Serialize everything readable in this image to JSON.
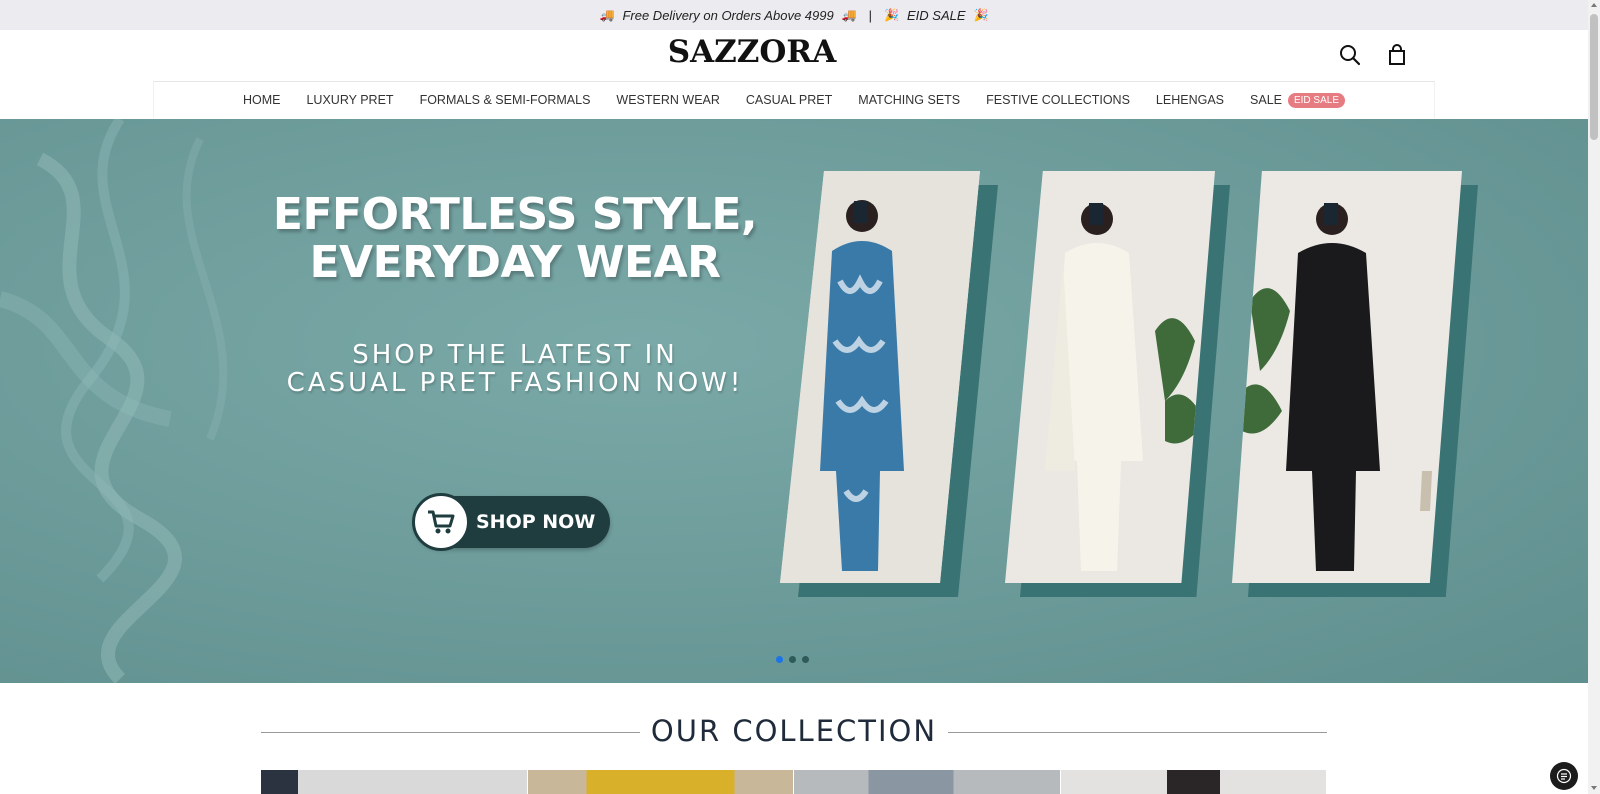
{
  "announcement": {
    "left_emoji": "🚚",
    "free_delivery": "Free Delivery on Orders Above 4999",
    "right_emoji": "🚚",
    "separator": "|",
    "sale_emoji": "🎉",
    "eid_sale": "EID SALE",
    "sale_emoji_end": "🎉"
  },
  "header": {
    "logo": "SAZZORA",
    "icons": [
      "search-icon",
      "shopping-bag-icon"
    ]
  },
  "nav": {
    "items": [
      {
        "label": "HOME"
      },
      {
        "label": "LUXURY PRET"
      },
      {
        "label": "FORMALS & SEMI-FORMALS"
      },
      {
        "label": "WESTERN WEAR"
      },
      {
        "label": "CASUAL PRET"
      },
      {
        "label": "MATCHING SETS"
      },
      {
        "label": "FESTIVE COLLECTIONS"
      },
      {
        "label": "LEHENGAS"
      },
      {
        "label": "SALE",
        "badge": "EID SALE"
      }
    ]
  },
  "hero": {
    "title_line1": "EFFORTLESS STYLE,",
    "title_line2": "EVERYDAY WEAR",
    "sub_line1": "SHOP THE LATEST IN",
    "sub_line2": "CASUAL PRET FASHION NOW!",
    "cta": "SHOP NOW",
    "slides_total": 3,
    "active_slide": 1
  },
  "collection": {
    "title": "OUR COLLECTION"
  },
  "colors": {
    "hero_bg": "#6d9c9b",
    "cta_bg": "#1f3d3f",
    "badge": "#e77b82",
    "active_dot": "#1a73e8"
  }
}
